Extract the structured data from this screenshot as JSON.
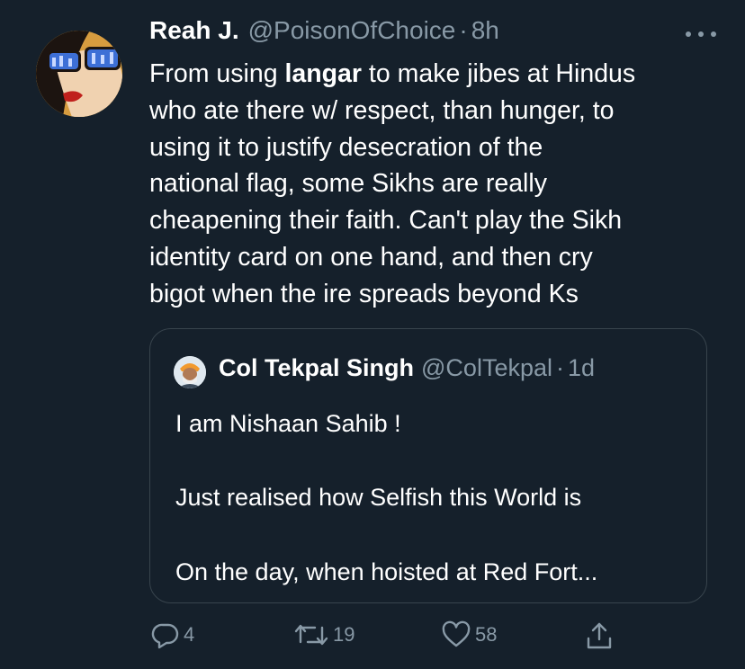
{
  "tweet": {
    "author_name": "Reah J.",
    "author_handle": "@PoisonOfChoice",
    "separator": "·",
    "time": "8h",
    "lines": [
      [
        "From using ",
        "langar",
        " to make jibes at Hindus"
      ],
      "who ate there w/ respect, than hunger, to",
      "using it to justify desecration of the",
      "national flag, some Sikhs are really",
      "cheapening their faith. Can't play the Sikh",
      "identity card on one hand, and then cry",
      "bigot when the ire spreads beyond Ks"
    ]
  },
  "quoted": {
    "author_name": "Col Tekpal Singh",
    "author_handle": "@ColTekpal",
    "separator": "·",
    "time": "1d",
    "lines": [
      "I am Nishaan Sahib !",
      "Just realised how Selfish this World is",
      "On the day, when hoisted at Red Fort..."
    ]
  },
  "actions": {
    "reply_count": "4",
    "retweet_count": "19",
    "like_count": "58"
  },
  "icons": {
    "more": "more-horizontal-icon",
    "reply": "reply-icon",
    "retweet": "retweet-icon",
    "like": "heart-icon",
    "share": "share-icon"
  },
  "colors": {
    "background": "#15202b",
    "secondary_text": "#8899a6",
    "border": "#38444d"
  }
}
